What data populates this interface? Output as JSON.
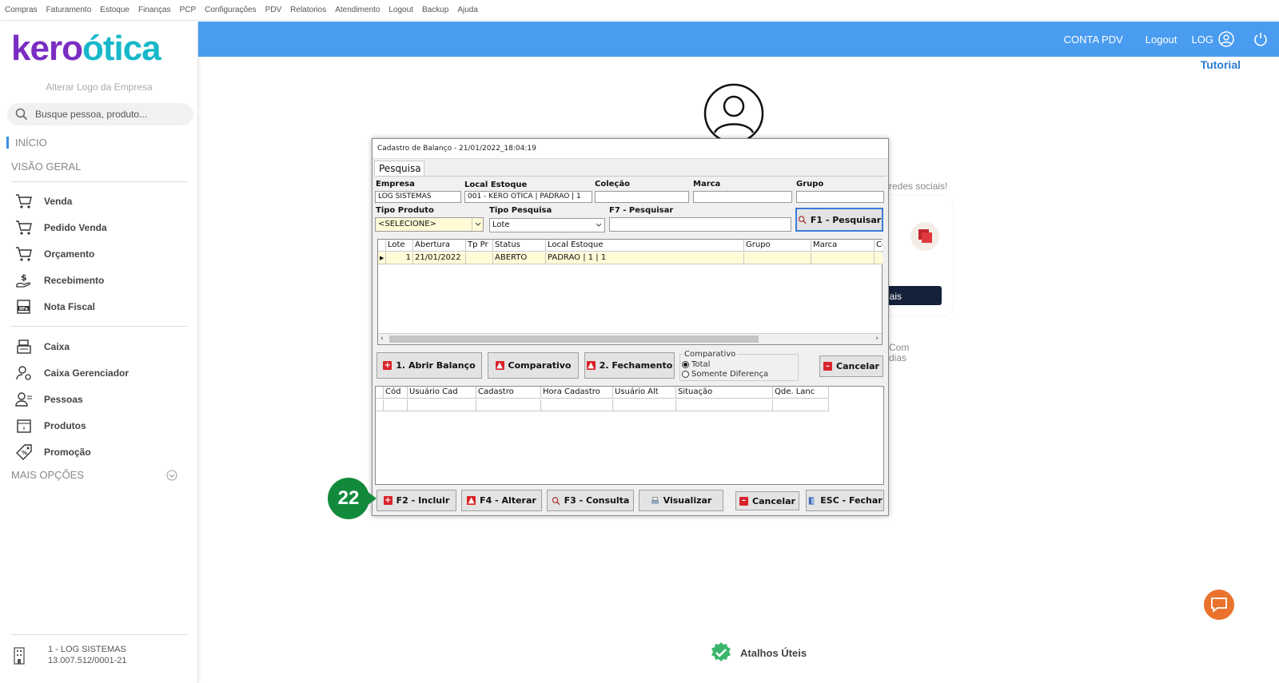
{
  "menubar": [
    "Compras",
    "Faturamento",
    "Estoque",
    "Finanças",
    "PCP",
    "Configurações",
    "PDV",
    "Relatorios",
    "Atendimento",
    "Logout",
    "Backup",
    "Ajuda"
  ],
  "sidebar": {
    "logo_part1": "kero",
    "logo_part2": "ótica",
    "alter_logo": "Alterar Logo da Empresa",
    "search_placeholder": "Busque pessoa, produto...",
    "inicio": "INÍCIO",
    "visao_geral": "VISÃO GERAL",
    "items": [
      "Venda",
      "Pedido Venda",
      "Orçamento",
      "Recebimento",
      "Nota Fiscal",
      "Caixa",
      "Caixa Gerenciador",
      "Pessoas",
      "Produtos",
      "Promoção"
    ],
    "mais_opcoes": "MAIS OPÇÕES",
    "company_name": "1 - LOG SISTEMAS",
    "company_cnpj": "13.007.512/0001-21"
  },
  "topbar": {
    "conta_pdv": "CONTA PDV",
    "logout": "Logout",
    "log": "LOG",
    "tutorial": "Tutorial"
  },
  "background": {
    "redes": "redes sociais!",
    "btn_fragment": "iais",
    "com_line1": "Com",
    "com_line2": "dias",
    "atalhos": "Atalhos Úteis"
  },
  "dialog": {
    "title": "Cadastro de Balanço - 21/01/2022_18:04:19",
    "tab": "Pesquisa",
    "labels": {
      "empresa": "Empresa",
      "local_estoque": "Local Estoque",
      "colecao": "Coleção",
      "marca": "Marca",
      "grupo": "Grupo",
      "tipo_produto": "Tipo Produto",
      "tipo_pesquisa": "Tipo Pesquisa",
      "f7": "F7 - Pesquisar"
    },
    "values": {
      "empresa": "LOG SISTEMAS",
      "local_estoque": "001 - KERO OTICA | PADRAO | 1",
      "colecao": "",
      "marca": "",
      "grupo": "",
      "tipo_produto": "<SELECIONE>",
      "tipo_pesquisa": "Lote",
      "f7": ""
    },
    "btn_pesquisar": "F1 - Pesquisar",
    "grid1_headers": [
      "Lote",
      "Abertura",
      "Tp Pr",
      "Status",
      "Local Estoque",
      "Grupo",
      "Marca",
      "Co"
    ],
    "grid1_row": [
      "1",
      "21/01/2022",
      "",
      "ABERTO",
      "PADRAO | 1 | 1",
      "",
      "",
      ""
    ],
    "btn_abrir": "1. Abrir Balanço",
    "btn_comparativo": "Comparativo",
    "btn_fechamento": "2. Fechamento",
    "comparativo_group": "Comparativo",
    "radio_total": "Total",
    "radio_diferenca": "Somente Diferença",
    "btn_cancelar1": "Cancelar",
    "grid2_headers": [
      "Cód",
      "Usuário Cad",
      "Cadastro",
      "Hora Cadastro",
      "Usuário Alt",
      "Situação",
      "Qde. Lanc"
    ],
    "btn_incluir": "F2 - Incluir",
    "btn_alterar": "F4 - Alterar",
    "btn_consulta": "F3 - Consulta",
    "btn_visualizar": "Visualizar",
    "btn_cancelar2": "Cancelar",
    "btn_fechar": "ESC - Fechar"
  },
  "step_marker": "22",
  "colors": {
    "topbar": "#4a9cf0",
    "accent": "#3a8ee6",
    "step": "#128a3c",
    "chat": "#e9732c",
    "logo_purple": "#7a2dc2",
    "logo_teal": "#17b8c9"
  }
}
